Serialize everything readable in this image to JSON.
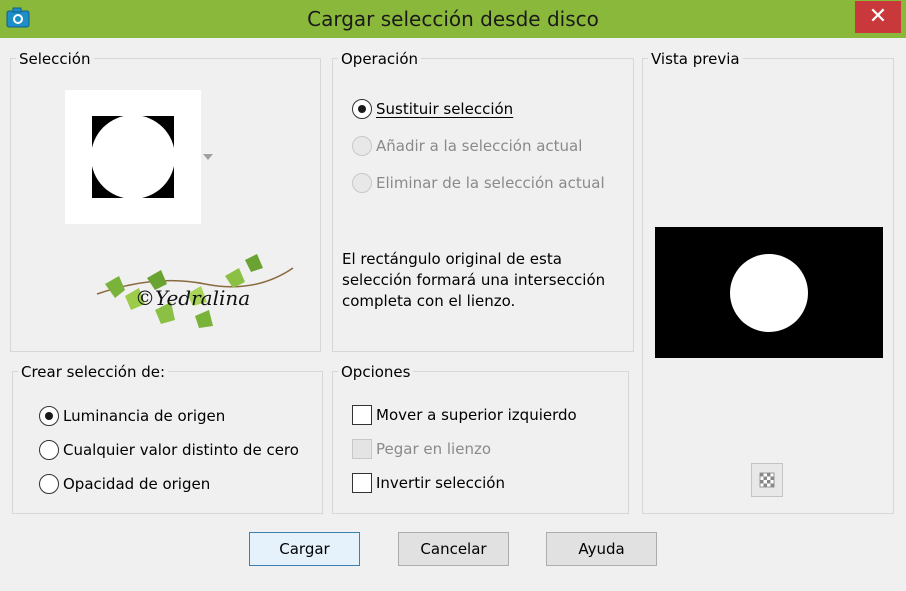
{
  "window": {
    "title": "Cargar selección desde disco",
    "close_label": "✕"
  },
  "seleccion": {
    "label": "Selección",
    "watermark": "©Yedralina"
  },
  "operacion": {
    "label": "Operación",
    "options": [
      {
        "label": "Sustituir selección",
        "checked": true,
        "disabled": false
      },
      {
        "label": "Añadir a la selección actual",
        "checked": false,
        "disabled": true
      },
      {
        "label": "Eliminar de la selección actual",
        "checked": false,
        "disabled": true
      }
    ],
    "description": "El rectángulo original de esta selección formará una intersección completa con el lienzo."
  },
  "vista_previa": {
    "label": "Vista previa"
  },
  "crear": {
    "label": "Crear selección de:",
    "options": [
      {
        "label": "Luminancia de origen",
        "checked": true
      },
      {
        "label": "Cualquier valor distinto de cero",
        "checked": false
      },
      {
        "label": "Opacidad de origen",
        "checked": false
      }
    ]
  },
  "opciones": {
    "label": "Opciones",
    "items": [
      {
        "label": "Mover a superior izquierdo",
        "checked": false,
        "disabled": false
      },
      {
        "label": "Pegar en lienzo",
        "checked": false,
        "disabled": true
      },
      {
        "label": "Invertir selección",
        "checked": false,
        "disabled": false
      }
    ]
  },
  "buttons": {
    "load": "Cargar",
    "cancel": "Cancelar",
    "help": "Ayuda"
  },
  "colors": {
    "titlebar": "#8ab83a",
    "close": "#c9383a"
  }
}
